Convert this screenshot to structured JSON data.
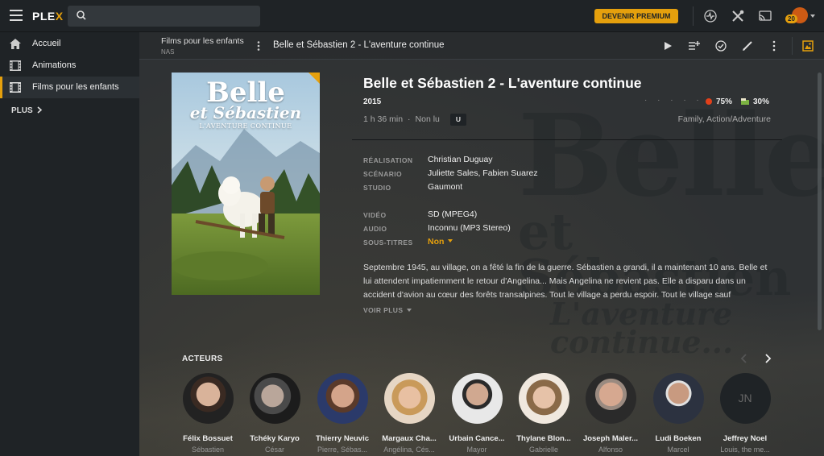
{
  "app": {
    "logo": "PLEX",
    "logo_accent": "X",
    "premium_label": "DEVENIR PREMIUM",
    "notifications": "20"
  },
  "sidebar": {
    "items": [
      {
        "label": "Accueil",
        "icon": "home-icon"
      },
      {
        "label": "Animations",
        "icon": "film-icon"
      },
      {
        "label": "Films pour les enfants",
        "icon": "film-icon",
        "active": true
      }
    ],
    "more_label": "PLUS"
  },
  "subbar": {
    "library": "Films pour les enfants",
    "server": "NAS",
    "title": "Belle et Sébastien 2 - L'aventure continue"
  },
  "movie": {
    "title": "Belle et Sébastien 2 - L'aventure continue",
    "year": "2015",
    "duration": "1 h 36 min",
    "watch_status": "Non lu",
    "rating_badge": "U",
    "critic_rating": "75%",
    "audience_rating": "30%",
    "genres": "Family, Action/Adventure",
    "poster": {
      "line1": "Belle",
      "line2": "et Sébastien",
      "line3": "L'AVENTURE CONTINUE"
    },
    "background_text": {
      "line1": "Belle",
      "line2": "et Sébastien",
      "line3": "L'aventure continue..."
    },
    "details": [
      {
        "label": "RÉALISATION",
        "value": "Christian Duguay"
      },
      {
        "label": "SCÉNARIO",
        "value": "Juliette Sales, Fabien Suarez"
      },
      {
        "label": "STUDIO",
        "value": "Gaumont"
      },
      {
        "label": "VIDÉO",
        "value": "SD (MPEG4)"
      },
      {
        "label": "AUDIO",
        "value": "Inconnu (MP3 Stereo)"
      },
      {
        "label": "SOUS-TITRES",
        "value": "Non"
      }
    ],
    "summary": "Septembre 1945, au village, on a fêté la fin de la guerre. Sébastien a grandi, il a maintenant 10 ans. Belle et lui attendent impatiemment le retour d'Angelina... Mais Angelina ne revient pas. Elle a disparu dans un accident d'avion au cœur des forêts transalpines. Tout le village a perdu espoir. Tout le village sauf",
    "more_label": "VOIR PLUS"
  },
  "actors": {
    "title": "ACTEURS",
    "list": [
      {
        "name": "Félix Bossuet",
        "role": "Sébastien"
      },
      {
        "name": "Tchéky Karyo",
        "role": "César"
      },
      {
        "name": "Thierry Neuvic",
        "role": "Pierre, Sébas..."
      },
      {
        "name": "Margaux Cha...",
        "role": "Angélina, Cés..."
      },
      {
        "name": "Urbain Cance...",
        "role": "Mayor"
      },
      {
        "name": "Thylane Blon...",
        "role": "Gabrielle"
      },
      {
        "name": "Joseph Maler...",
        "role": "Alfonso"
      },
      {
        "name": "Ludi Boeken",
        "role": "Marcel"
      },
      {
        "name": "Jeffrey Noel",
        "role": "Louis, the me...",
        "initials": "JN"
      }
    ]
  },
  "colors": {
    "accent": "#e5a00d",
    "background": "#1f2326",
    "critic_red": "#e2401a"
  }
}
